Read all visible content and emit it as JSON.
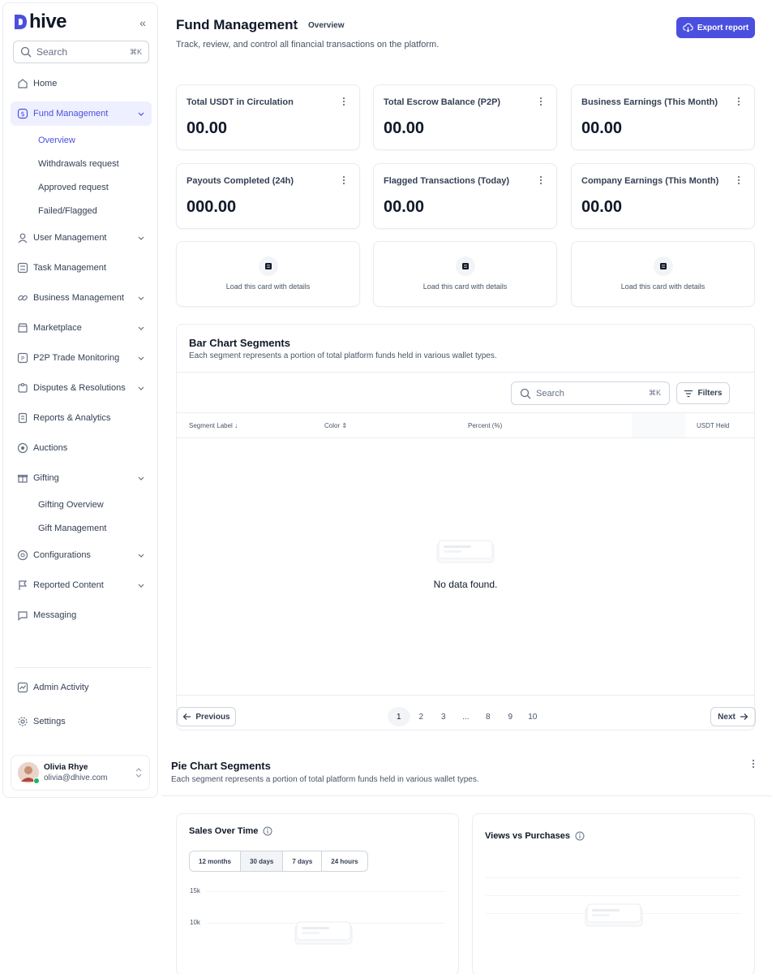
{
  "app": {
    "logo_text": "hive"
  },
  "sidebar": {
    "search_placeholder": "Search",
    "search_shortcut": "⌘K",
    "items": [
      {
        "label": "Home"
      },
      {
        "label": "Fund Management"
      },
      {
        "label": "User Management"
      },
      {
        "label": "Task Management"
      },
      {
        "label": "Business Management"
      },
      {
        "label": "Marketplace"
      },
      {
        "label": "P2P Trade Monitoring"
      },
      {
        "label": "Disputes & Resolutions"
      },
      {
        "label": "Reports & Analytics"
      },
      {
        "label": "Auctions"
      },
      {
        "label": "Gifting"
      },
      {
        "label": "Configurations"
      },
      {
        "label": "Reported Content"
      },
      {
        "label": "Messaging"
      }
    ],
    "fund_sub": [
      "Overview",
      "Withdrawals request",
      "Approved request",
      "Failed/Flagged"
    ],
    "gifting_sub": [
      "Gifting Overview",
      "Gift Management"
    ],
    "bottom": [
      {
        "label": "Admin Activity"
      },
      {
        "label": "Settings"
      }
    ],
    "user": {
      "name": "Olivia Rhye",
      "email": "olivia@dhive.com"
    }
  },
  "header": {
    "title": "Fund Management",
    "breadcrumb": "Overview",
    "subtitle": "Track, review, and control all financial transactions on the platform.",
    "export_label": "Export report"
  },
  "stats": [
    {
      "title": "Total USDT in Circulation",
      "value": "00.00"
    },
    {
      "title": "Total Escrow Balance (P2P)",
      "value": "00.00"
    },
    {
      "title": "Business Earnings (This Month)",
      "value": "00.00"
    },
    {
      "title": "Payouts Completed (24h)",
      "value": "000.00"
    },
    {
      "title": "Flagged Transactions (Today)",
      "value": "00.00"
    },
    {
      "title": "Company Earnings (This Month)",
      "value": "00.00"
    }
  ],
  "load_cards": [
    "Load this card with details",
    "Load this card with details",
    "Load this card with details"
  ],
  "bar_panel": {
    "title": "Bar Chart Segments",
    "subtitle": "Each segment represents a portion of total platform funds held in various wallet types.",
    "search_placeholder": "Search",
    "search_shortcut": "⌘K",
    "filters_label": "Filters",
    "columns": [
      "Segment Label",
      "Color",
      "Percent (%)",
      "USDT Held"
    ],
    "empty_text": "No data found.",
    "prev_label": "Previous",
    "next_label": "Next",
    "pages": [
      "1",
      "2",
      "3",
      "...",
      "8",
      "9",
      "10"
    ]
  },
  "pie_panel": {
    "title": "Pie Chart Segments",
    "subtitle": "Each segment represents a portion of total platform funds held in various wallet types."
  },
  "sales_card": {
    "title": "Sales Over Time",
    "ranges": [
      "12 months",
      "30 days",
      "7 days",
      "24 hours"
    ],
    "y_ticks": [
      "15k",
      "10k"
    ]
  },
  "views_card": {
    "title": "Views vs Purchases"
  },
  "colors": {
    "accent": "#4b4fe0",
    "active_bg": "#eef0ff"
  }
}
